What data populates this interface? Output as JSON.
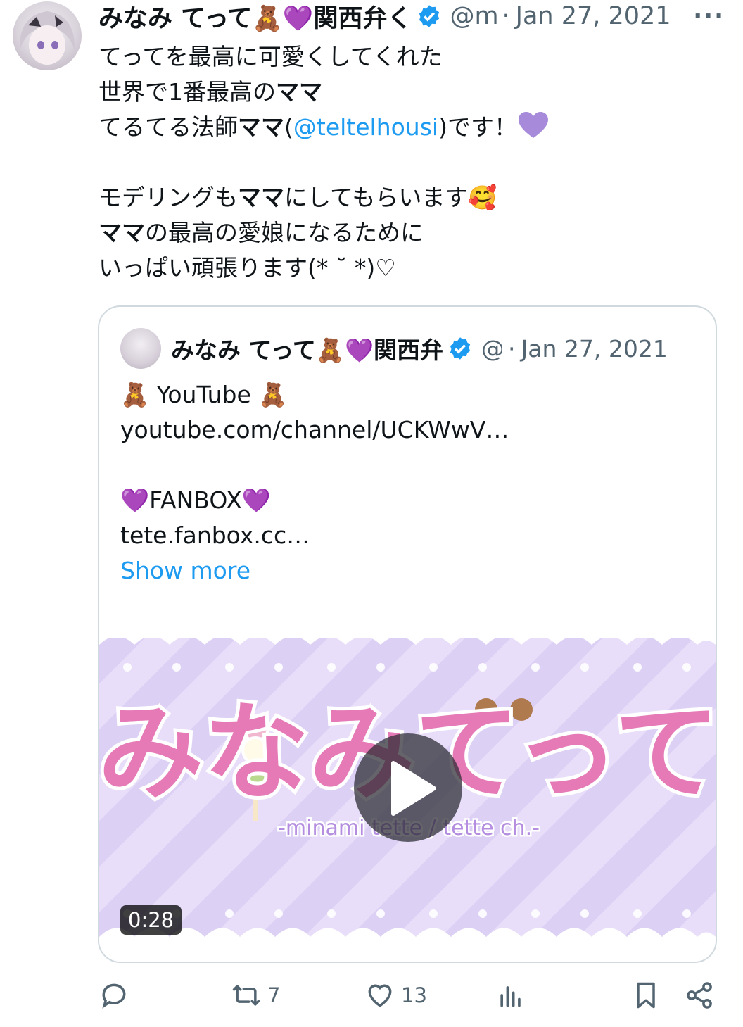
{
  "author": {
    "display_name": "みなみ てって🧸💜関西弁く",
    "handle": "@m",
    "separator": "·",
    "date": "Jan 27, 2021"
  },
  "more_label": "···",
  "tweet": {
    "line1": "てってを最高に可愛くしてくれた",
    "line2_a": "世界で1番最高の",
    "line2_b": "ママ",
    "line3_a": "てるてる法師",
    "line3_b": "ママ",
    "line3_c": "(",
    "line3_mention": "@teltelhousi",
    "line3_d": ")です！",
    "line5_a": "モデリングも",
    "line5_b": "ママ",
    "line5_c": "にしてもらいます🥰",
    "line6_a": "ママ",
    "line6_b": "の最高の愛娘になるために",
    "line7": "いっぱい頑張ります(* ˘ *)♡"
  },
  "quote": {
    "display_name": "みなみ てって🧸💜関西弁",
    "handle": "@",
    "separator": "·",
    "date": "Jan 27, 2021",
    "lines": [
      "🧸 YouTube 🧸",
      "youtube.com/channel/UCKWwV…",
      "",
      "💜FANBOX💜",
      "tete.fanbox.cc…"
    ],
    "show_more": "Show more",
    "media": {
      "logo_text": "みなみてって",
      "logo_subtitle": "-minami tette / tette ch.-",
      "duration": "0:28"
    }
  },
  "actions": {
    "reply_count": "",
    "retweet_count": "7",
    "like_count": "13",
    "views_count": ""
  },
  "icons": {
    "verified": "verified-badge-icon",
    "reply": "reply-icon",
    "retweet": "retweet-icon",
    "like": "heart-icon",
    "views": "views-icon",
    "bookmark": "bookmark-icon",
    "share": "share-icon",
    "play": "play-icon"
  },
  "colors": {
    "link": "#1d9bf0",
    "muted": "#536471",
    "verified": "#1d9bf0",
    "purple_heart": "#a78bda",
    "media_bg": "#dcd0f5"
  }
}
